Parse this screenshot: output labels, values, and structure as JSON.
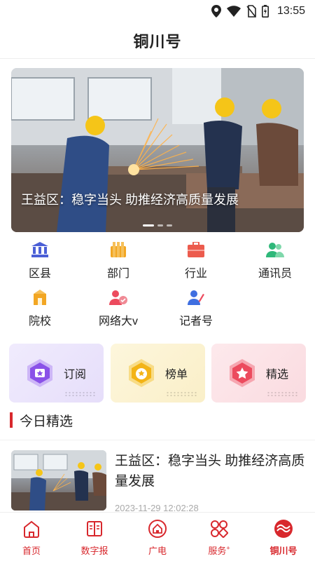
{
  "status_bar": {
    "time": "13:55",
    "icons": [
      "location-icon",
      "wifi-icon",
      "no-sim-icon",
      "battery-icon"
    ]
  },
  "header": {
    "title": "铜川号"
  },
  "banner": {
    "title": "王益区：稳字当头 助推经济高质量发展",
    "slide_count": 3,
    "active_slide": 1
  },
  "categories": [
    {
      "label": "区县",
      "icon": "county-building-icon",
      "color": "#4b5fd6"
    },
    {
      "label": "部门",
      "icon": "department-icon",
      "color": "#f2a623"
    },
    {
      "label": "行业",
      "icon": "industry-briefcase-icon",
      "color": "#ec5b4d"
    },
    {
      "label": "通讯员",
      "icon": "correspondent-people-icon",
      "color": "#2fb87a"
    },
    {
      "label": "院校",
      "icon": "school-icon",
      "color": "#f2a623"
    },
    {
      "label": "网络大v",
      "icon": "network-influencer-icon",
      "color": "#ec4b5e"
    },
    {
      "label": "记者号",
      "icon": "reporter-icon",
      "color": "#3f6fe0"
    }
  ],
  "features": [
    {
      "label": "订阅",
      "icon": "subscribe-icon",
      "color": "#8a52e8",
      "bg": "#ece6fb"
    },
    {
      "label": "榜单",
      "icon": "ranking-icon",
      "color": "#f3b417",
      "bg": "#fbf3d6"
    },
    {
      "label": "精选",
      "icon": "featured-star-icon",
      "color": "#ec4b5e",
      "bg": "#fbe3e6"
    }
  ],
  "section": {
    "title": "今日精选"
  },
  "news": [
    {
      "title": "王益区：稳字当头 助推经济高质量发展",
      "time": "2023-11-29 12:02:28"
    }
  ],
  "bottom_nav": [
    {
      "label": "首页",
      "icon": "home-icon"
    },
    {
      "label": "数字报",
      "icon": "digital-paper-icon"
    },
    {
      "label": "广电",
      "icon": "broadcast-icon"
    },
    {
      "label": "服务",
      "superscript": "+",
      "icon": "services-grid-icon"
    },
    {
      "label": "铜川号",
      "icon": "tongchuan-logo-icon",
      "active": true
    }
  ],
  "colors": {
    "accent": "#d8282d",
    "text": "#222222",
    "muted": "#aaaaaa"
  }
}
